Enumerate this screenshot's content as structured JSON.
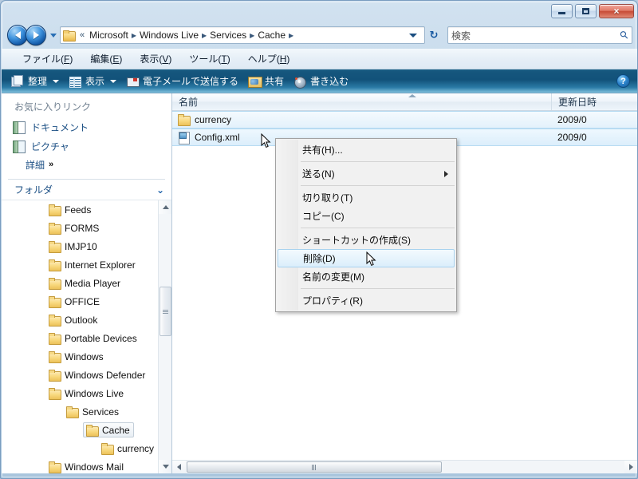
{
  "window": {
    "minimize_label": "最小化",
    "maximize_label": "最大化",
    "close_label": "×"
  },
  "address_bar": {
    "back_label": "戻る",
    "forward_label": "進む",
    "history_label": "最近表示したページ",
    "overflow_crumb": "«",
    "breadcrumbs": [
      {
        "label": "Microsoft"
      },
      {
        "label": "Windows Live"
      },
      {
        "label": "Services"
      },
      {
        "label": "Cache"
      }
    ],
    "dropdown_label": "以前の場所",
    "refresh_label": "最新の情報に更新",
    "refresh_glyph": "↻"
  },
  "search": {
    "placeholder": "検索",
    "value": "検索",
    "icon": "search-icon"
  },
  "menubar": {
    "items": [
      {
        "pre": "ファイル(",
        "key": "F",
        "post": ")"
      },
      {
        "pre": "編集(",
        "key": "E",
        "post": ")"
      },
      {
        "pre": "表示(",
        "key": "V",
        "post": ")"
      },
      {
        "pre": "ツール(",
        "key": "T",
        "post": ")"
      },
      {
        "pre": "ヘルプ(",
        "key": "H",
        "post": ")"
      }
    ]
  },
  "toolbar": {
    "organize_label": "整理",
    "views_label": "表示",
    "email_label": "電子メールで送信する",
    "share_label": "共有",
    "burn_label": "書き込む",
    "help_label": "?"
  },
  "navpane": {
    "favorites_header": "お気に入りリンク",
    "favorites": [
      {
        "label": "ドキュメント",
        "icon": "documents-icon"
      },
      {
        "label": "ピクチャ",
        "icon": "pictures-icon"
      }
    ],
    "more_label": "詳細",
    "more_chevron": "»",
    "folders_title": "フォルダ",
    "folders_chevron": "⌄",
    "tree": [
      {
        "label": "Feeds",
        "indent": 0,
        "selected": false
      },
      {
        "label": "FORMS",
        "indent": 0,
        "selected": false
      },
      {
        "label": "IMJP10",
        "indent": 0,
        "selected": false
      },
      {
        "label": "Internet Explorer",
        "indent": 0,
        "selected": false
      },
      {
        "label": "Media Player",
        "indent": 0,
        "selected": false
      },
      {
        "label": "OFFICE",
        "indent": 0,
        "selected": false
      },
      {
        "label": "Outlook",
        "indent": 0,
        "selected": false
      },
      {
        "label": "Portable Devices",
        "indent": 0,
        "selected": false
      },
      {
        "label": "Windows",
        "indent": 0,
        "selected": false
      },
      {
        "label": "Windows Defender",
        "indent": 0,
        "selected": false
      },
      {
        "label": "Windows Live",
        "indent": 0,
        "selected": false
      },
      {
        "label": "Services",
        "indent": 1,
        "selected": false
      },
      {
        "label": "Cache",
        "indent": 2,
        "selected": true
      },
      {
        "label": "currency",
        "indent": 3,
        "selected": false
      },
      {
        "label": "Windows Mail",
        "indent": 0,
        "selected": false
      }
    ]
  },
  "filepane": {
    "columns": [
      {
        "label": "名前"
      },
      {
        "label": "更新日時"
      }
    ],
    "rows": [
      {
        "name": "currency",
        "date": "2009/0",
        "icon": "folder-icon",
        "selected": true,
        "focused": false
      },
      {
        "name": "Config.xml",
        "date": "2009/0",
        "icon": "xml-file-icon",
        "selected": true,
        "focused": true
      }
    ]
  },
  "context_menu": {
    "items": [
      {
        "label": "共有(H)...",
        "type": "item",
        "submenu": false,
        "highlight": false
      },
      {
        "type": "separator"
      },
      {
        "label": "送る(N)",
        "type": "item",
        "submenu": true,
        "highlight": false
      },
      {
        "type": "separator"
      },
      {
        "label": "切り取り(T)",
        "type": "item",
        "submenu": false,
        "highlight": false
      },
      {
        "label": "コピー(C)",
        "type": "item",
        "submenu": false,
        "highlight": false
      },
      {
        "type": "separator"
      },
      {
        "label": "ショートカットの作成(S)",
        "type": "item",
        "submenu": false,
        "highlight": false
      },
      {
        "label": "削除(D)",
        "type": "item",
        "submenu": false,
        "highlight": true
      },
      {
        "label": "名前の変更(M)",
        "type": "item",
        "submenu": false,
        "highlight": false
      },
      {
        "type": "separator"
      },
      {
        "label": "プロパティ(R)",
        "type": "item",
        "submenu": false,
        "highlight": false
      }
    ]
  },
  "colors": {
    "toolbar_dark": "#12527a",
    "toolbar_light": "#7fc0dc",
    "frame": "#b4cde2",
    "selection": "#dceefb",
    "link_text": "#1b4f84",
    "close_button": "#c64b36"
  }
}
